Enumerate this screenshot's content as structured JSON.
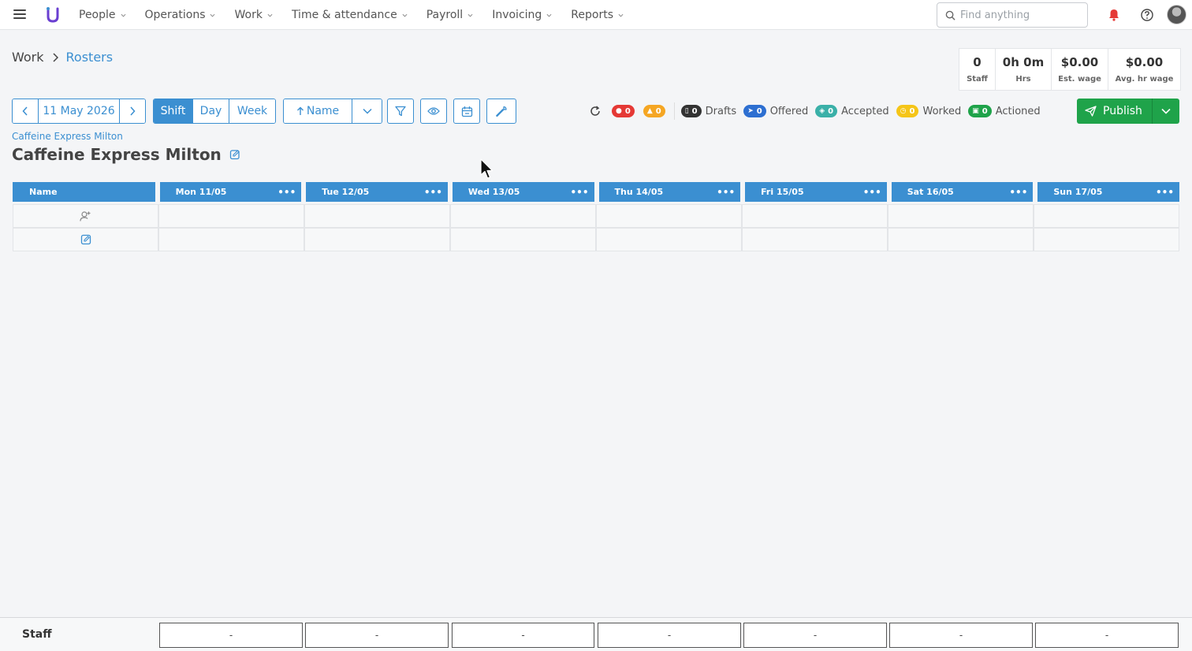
{
  "nav": {
    "items": [
      {
        "label": "People"
      },
      {
        "label": "Operations"
      },
      {
        "label": "Work"
      },
      {
        "label": "Time & attendance"
      },
      {
        "label": "Payroll"
      },
      {
        "label": "Invoicing"
      },
      {
        "label": "Reports"
      }
    ],
    "search_placeholder": "Find anything"
  },
  "breadcrumb": {
    "parent": "Work",
    "current": "Rosters"
  },
  "stats": [
    {
      "value": "0",
      "label": "Staff"
    },
    {
      "value": "0h 0m",
      "label": "Hrs"
    },
    {
      "value": "$0.00",
      "label": "Est. wage"
    },
    {
      "value": "$0.00",
      "label": "Avg. hr wage"
    }
  ],
  "toolbar": {
    "date": "11 May 2026",
    "views": [
      "Shift",
      "Day",
      "Week"
    ],
    "active_view": "Shift",
    "sort_label": "Name"
  },
  "status": {
    "errors": "0",
    "warnings": "0",
    "drafts_count": "0",
    "drafts_label": "Drafts",
    "offered_count": "0",
    "offered_label": "Offered",
    "accepted_count": "0",
    "accepted_label": "Accepted",
    "worked_count": "0",
    "worked_label": "Worked",
    "actioned_count": "0",
    "actioned_label": "Actioned"
  },
  "publish_label": "Publish",
  "location": {
    "link": "Caffeine Express Milton",
    "title": "Caffeine Express Milton"
  },
  "grid": {
    "name_header": "Name",
    "days": [
      "Mon 11/05",
      "Tue 12/05",
      "Wed 13/05",
      "Thu 14/05",
      "Fri 15/05",
      "Sat 16/05",
      "Sun 17/05"
    ]
  },
  "footer": {
    "label": "Staff",
    "values": [
      "-",
      "-",
      "-",
      "-",
      "-",
      "-",
      "-"
    ]
  },
  "colors": {
    "accent": "#3b8fd1",
    "publish": "#1fa34a",
    "error": "#e53935",
    "warning": "#f5a623",
    "drafts": "#333333",
    "offered": "#2d6fd1",
    "accepted": "#3ab0a8",
    "worked": "#f5c518",
    "actioned": "#1fa34a"
  }
}
